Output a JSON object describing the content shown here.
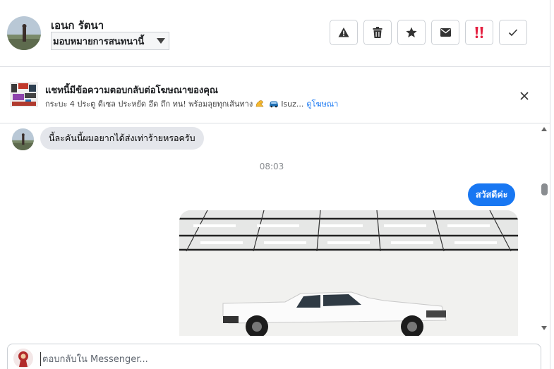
{
  "header": {
    "contact_name": "เอนก รัตนา",
    "assign_label": "มอบหมายการสนทนานี้",
    "toolbar": [
      {
        "icon": "warning-icon"
      },
      {
        "icon": "trash-icon"
      },
      {
        "icon": "star-icon"
      },
      {
        "icon": "envelope-icon"
      },
      {
        "icon": "double-exclamation-icon"
      },
      {
        "icon": "check-icon"
      }
    ]
  },
  "ad_banner": {
    "title": "แชทนี้มีข้อความตอบกลับต่อโฆษณาของคุณ",
    "description_start": "กระบะ 4 ประตู ดีเซล ประหยัด อึด ถึก ทน! พร้อมลุยทุกเส้นทาง",
    "description_end": "Isuz...",
    "link": "ดูโฆษณา"
  },
  "chat": {
    "incoming_message": "นี้ละคันนี้ผมอยากได้ส่งเท่าร้ายหรอครับ",
    "timestamp": "08:03",
    "outgoing_message": "สวัสดีค่ะ"
  },
  "composer": {
    "placeholder": "ตอบกลับใน Messenger..."
  },
  "colors": {
    "accent": "#1877f2",
    "incoming_bubble": "#e4e6eb",
    "alert_icon": "#e41e3f"
  }
}
